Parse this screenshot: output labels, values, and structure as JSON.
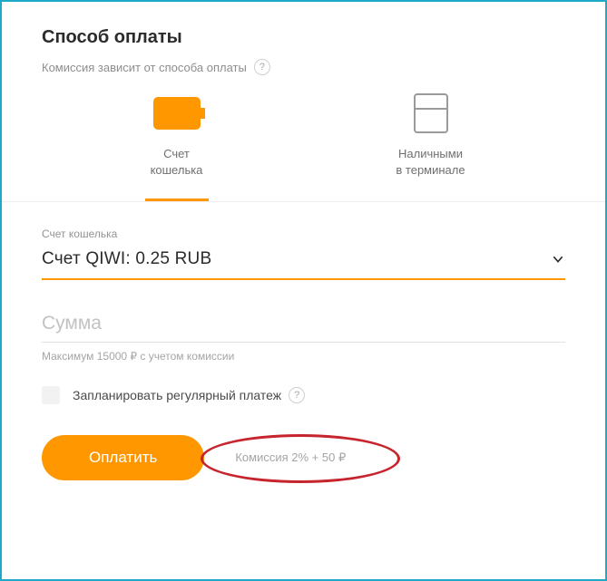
{
  "header": {
    "title": "Способ оплаты",
    "commission_note": "Комиссия зависит от способа оплаты"
  },
  "methods": {
    "wallet": {
      "line1": "Счет",
      "line2": "кошелька"
    },
    "terminal": {
      "line1": "Наличными",
      "line2": "в терминале"
    }
  },
  "account_select": {
    "label": "Счет кошелька",
    "value": "Счет QIWI: 0.25 RUB"
  },
  "amount": {
    "placeholder": "Сумма",
    "helper": "Максимум 15000 ₽ с учетом комиссии"
  },
  "schedule": {
    "label": "Запланировать регулярный платеж"
  },
  "actions": {
    "pay_label": "Оплатить",
    "commission_text": "Комиссия 2% + 50 ₽"
  }
}
